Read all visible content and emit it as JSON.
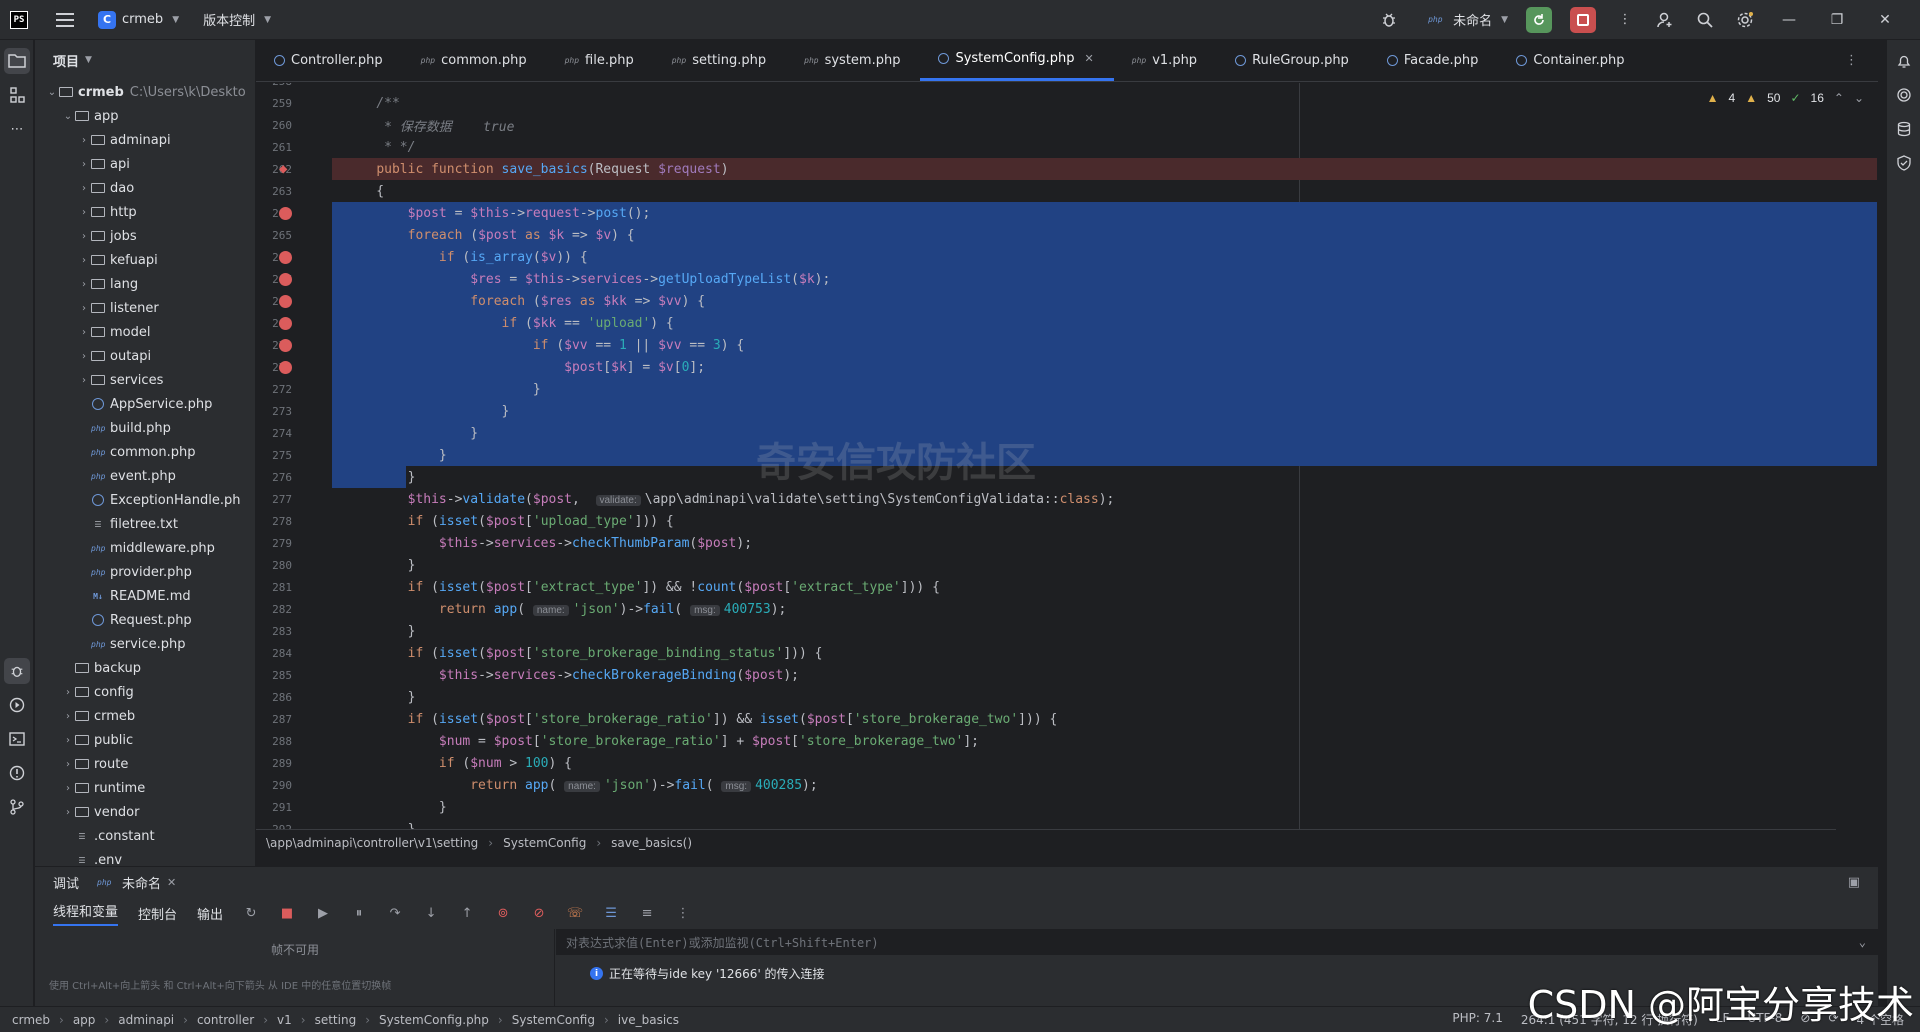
{
  "titlebar": {
    "logo": "PS",
    "project_badge": "C",
    "project_name": "crmeb",
    "vcs_label": "版本控制",
    "run_config": "未命名"
  },
  "project_panel": {
    "header": "项目",
    "root_name": "crmeb",
    "root_path": "C:\\Users\\k\\Deskto",
    "items": [
      {
        "label": "app",
        "depth": 1,
        "kind": "folder",
        "open": true
      },
      {
        "label": "adminapi",
        "depth": 2,
        "kind": "folder"
      },
      {
        "label": "api",
        "depth": 2,
        "kind": "folder"
      },
      {
        "label": "dao",
        "depth": 2,
        "kind": "folder"
      },
      {
        "label": "http",
        "depth": 2,
        "kind": "folder"
      },
      {
        "label": "jobs",
        "depth": 2,
        "kind": "folder"
      },
      {
        "label": "kefuapi",
        "depth": 2,
        "kind": "folder"
      },
      {
        "label": "lang",
        "depth": 2,
        "kind": "folder"
      },
      {
        "label": "listener",
        "depth": 2,
        "kind": "folder"
      },
      {
        "label": "model",
        "depth": 2,
        "kind": "folder"
      },
      {
        "label": "outapi",
        "depth": 2,
        "kind": "folder"
      },
      {
        "label": "services",
        "depth": 2,
        "kind": "folder"
      },
      {
        "label": "AppService.php",
        "depth": 2,
        "kind": "class"
      },
      {
        "label": "build.php",
        "depth": 2,
        "kind": "php"
      },
      {
        "label": "common.php",
        "depth": 2,
        "kind": "php"
      },
      {
        "label": "event.php",
        "depth": 2,
        "kind": "php"
      },
      {
        "label": "ExceptionHandle.ph",
        "depth": 2,
        "kind": "class"
      },
      {
        "label": "filetree.txt",
        "depth": 2,
        "kind": "text"
      },
      {
        "label": "middleware.php",
        "depth": 2,
        "kind": "php"
      },
      {
        "label": "provider.php",
        "depth": 2,
        "kind": "php"
      },
      {
        "label": "README.md",
        "depth": 2,
        "kind": "md"
      },
      {
        "label": "Request.php",
        "depth": 2,
        "kind": "class"
      },
      {
        "label": "service.php",
        "depth": 2,
        "kind": "php"
      },
      {
        "label": "backup",
        "depth": 1,
        "kind": "folder-leaf"
      },
      {
        "label": "config",
        "depth": 1,
        "kind": "folder"
      },
      {
        "label": "crmeb",
        "depth": 1,
        "kind": "folder"
      },
      {
        "label": "public",
        "depth": 1,
        "kind": "folder"
      },
      {
        "label": "route",
        "depth": 1,
        "kind": "folder"
      },
      {
        "label": "runtime",
        "depth": 1,
        "kind": "folder"
      },
      {
        "label": "vendor",
        "depth": 1,
        "kind": "folder"
      },
      {
        "label": ".constant",
        "depth": 1,
        "kind": "text"
      },
      {
        "label": ".env",
        "depth": 1,
        "kind": "text"
      }
    ]
  },
  "tabs": [
    {
      "label": "Controller.php",
      "kind": "class",
      "active": false
    },
    {
      "label": "common.php",
      "kind": "php",
      "active": false
    },
    {
      "label": "file.php",
      "kind": "php",
      "active": false
    },
    {
      "label": "setting.php",
      "kind": "php",
      "active": false
    },
    {
      "label": "system.php",
      "kind": "php",
      "active": false
    },
    {
      "label": "SystemConfig.php",
      "kind": "class",
      "active": true
    },
    {
      "label": "v1.php",
      "kind": "php",
      "active": false
    },
    {
      "label": "RuleGroup.php",
      "kind": "class",
      "active": false
    },
    {
      "label": "Facade.php",
      "kind": "class",
      "active": false
    },
    {
      "label": "Container.php",
      "kind": "class",
      "active": false
    }
  ],
  "inspections": {
    "warnings": "4",
    "weak_warnings": "50",
    "ok": "16"
  },
  "code_lines": [
    {
      "n": "258",
      "html": ""
    },
    {
      "n": "259",
      "html": "    <span class='cmt'>/**</span>"
    },
    {
      "n": "260",
      "html": "     <span class='cmt'>* 保存数据    true</span>"
    },
    {
      "n": "261",
      "html": "     <span class='cmt'>* */</span>"
    },
    {
      "n": "262",
      "html": "    <span class='kw'>public function</span> <span class='fn'>save_basics</span>(Request <span class='prm'>$request</span>)",
      "exec": true
    },
    {
      "n": "263",
      "html": "    {"
    },
    {
      "n": "264",
      "html": "        <span class='var'>$post</span> = <span class='var'>$this</span>-><span class='var'>request</span>-><span class='fn'>post</span>();",
      "bp": true,
      "sel": true
    },
    {
      "n": "265",
      "html": "        <span class='kw'>foreach</span> (<span class='var'>$post</span> <span class='kw'>as</span> <span class='var'>$k</span> => <span class='var'>$v</span>) {",
      "sel": true
    },
    {
      "n": "266",
      "html": "            <span class='kw'>if</span> (<span class='fn'>is_array</span>(<span class='var'>$v</span>)) {",
      "bp": true,
      "sel": true
    },
    {
      "n": "267",
      "html": "                <span class='var'>$res</span> = <span class='var'>$this</span>-><span class='var'>services</span>-><span class='fn'>getUploadTypeList</span>(<span class='var'>$k</span>);",
      "bp": true,
      "sel": true
    },
    {
      "n": "268",
      "html": "                <span class='kw'>foreach</span> (<span class='var'>$res</span> <span class='kw'>as</span> <span class='var'>$kk</span> => <span class='var'>$vv</span>) {",
      "bp": true,
      "sel": true
    },
    {
      "n": "269",
      "html": "                    <span class='kw'>if</span> (<span class='var'>$kk</span> == <span class='str'>'upload'</span>) {",
      "bp": true,
      "sel": true
    },
    {
      "n": "270",
      "html": "                        <span class='kw'>if</span> (<span class='var'>$vv</span> == <span class='num'>1</span> || <span class='var'>$vv</span> == <span class='num'>3</span>) {",
      "bp": true,
      "sel": true
    },
    {
      "n": "271",
      "html": "                            <span class='var'>$post</span>[<span class='var'>$k</span>] = <span class='var'>$v</span>[<span class='num'>0</span>];",
      "bp": true,
      "sel": true
    },
    {
      "n": "272",
      "html": "                        }",
      "sel": true
    },
    {
      "n": "273",
      "html": "                    }",
      "sel": true
    },
    {
      "n": "274",
      "html": "                }",
      "sel": true
    },
    {
      "n": "275",
      "html": "            }",
      "sel": true
    },
    {
      "n": "276",
      "html": "        }",
      "sel": true,
      "partial": true
    },
    {
      "n": "277",
      "html": "        <span class='var'>$this</span>-><span class='fn'>validate</span>(<span class='var'>$post</span>,  <span class='hint'>validate:</span>\\app\\adminapi\\validate\\setting\\SystemConfigValidata::<span class='kw'>class</span>);"
    },
    {
      "n": "278",
      "html": "        <span class='kw'>if</span> (<span class='fn'>isset</span>(<span class='var'>$post</span>[<span class='str'>'upload_type'</span>])) {"
    },
    {
      "n": "279",
      "html": "            <span class='var'>$this</span>-><span class='var'>services</span>-><span class='fn'>checkThumbParam</span>(<span class='var'>$post</span>);"
    },
    {
      "n": "280",
      "html": "        }"
    },
    {
      "n": "281",
      "html": "        <span class='kw'>if</span> (<span class='fn'>isset</span>(<span class='var'>$post</span>[<span class='str'>'extract_type'</span>]) && !<span class='fn'>count</span>(<span class='var'>$post</span>[<span class='str'>'extract_type'</span>])) {"
    },
    {
      "n": "282",
      "html": "            <span class='kw'>return</span> <span class='fn'>app</span>( <span class='hint'>name:</span><span class='str'>'json'</span>)-><span class='fn'>fail</span>( <span class='hint'>msg:</span><span class='num'>400753</span>);"
    },
    {
      "n": "283",
      "html": "        }"
    },
    {
      "n": "284",
      "html": "        <span class='kw'>if</span> (<span class='fn'>isset</span>(<span class='var'>$post</span>[<span class='str'>'store_brokerage_binding_status'</span>])) {"
    },
    {
      "n": "285",
      "html": "            <span class='var'>$this</span>-><span class='var'>services</span>-><span class='fn'>checkBrokerageBinding</span>(<span class='var'>$post</span>);"
    },
    {
      "n": "286",
      "html": "        }"
    },
    {
      "n": "287",
      "html": "        <span class='kw'>if</span> (<span class='fn'>isset</span>(<span class='var'>$post</span>[<span class='str'>'store_brokerage_ratio'</span>]) && <span class='fn'>isset</span>(<span class='var'>$post</span>[<span class='str'>'store_brokerage_two'</span>])) {"
    },
    {
      "n": "288",
      "html": "            <span class='var'>$num</span> = <span class='var'>$post</span>[<span class='str'>'store_brokerage_ratio'</span>] + <span class='var'>$post</span>[<span class='str'>'store_brokerage_two'</span>];"
    },
    {
      "n": "289",
      "html": "            <span class='kw'>if</span> (<span class='var'>$num</span> > <span class='num'>100</span>) {"
    },
    {
      "n": "290",
      "html": "                <span class='kw'>return</span> <span class='fn'>app</span>( <span class='hint'>name:</span><span class='str'>'json'</span>)-><span class='fn'>fail</span>( <span class='hint'>msg:</span><span class='num'>400285</span>);"
    },
    {
      "n": "291",
      "html": "            }"
    },
    {
      "n": "292",
      "html": "        }"
    }
  ],
  "watermark": "奇安信攻防社区",
  "editor_breadcrumb": [
    "\\app\\adminapi\\controller\\v1\\setting",
    "SystemConfig",
    "save_basics()"
  ],
  "debug": {
    "tab_debug": "调试",
    "tab_session": "未命名",
    "sub_threads": "线程和变量",
    "sub_console": "控制台",
    "sub_output": "输出",
    "frames_empty": "帧不可用",
    "frames_hint": "使用 Ctrl+Alt+向上箭头 和 Ctrl+Alt+向下箭头 从 IDE 中的任意位置切换帧",
    "eval_placeholder": "对表达式求值(Enter)或添加监视(Ctrl+Shift+Enter)",
    "waiting_msg": "正在等待与ide key '12666' 的传入连接"
  },
  "statusbar": {
    "crumbs": [
      "crmeb",
      "app",
      "adminapi",
      "controller",
      "v1",
      "setting",
      "SystemConfig.php",
      "SystemConfig",
      "ive_basics"
    ],
    "php": "PHP: 7.1",
    "position": "264:1 (451 字符, 12 行 换行符)",
    "line_sep": "LF",
    "encoding": "UTF-8",
    "indent": "4 个空格"
  },
  "overlay": "CSDN @阿宝分享技术"
}
